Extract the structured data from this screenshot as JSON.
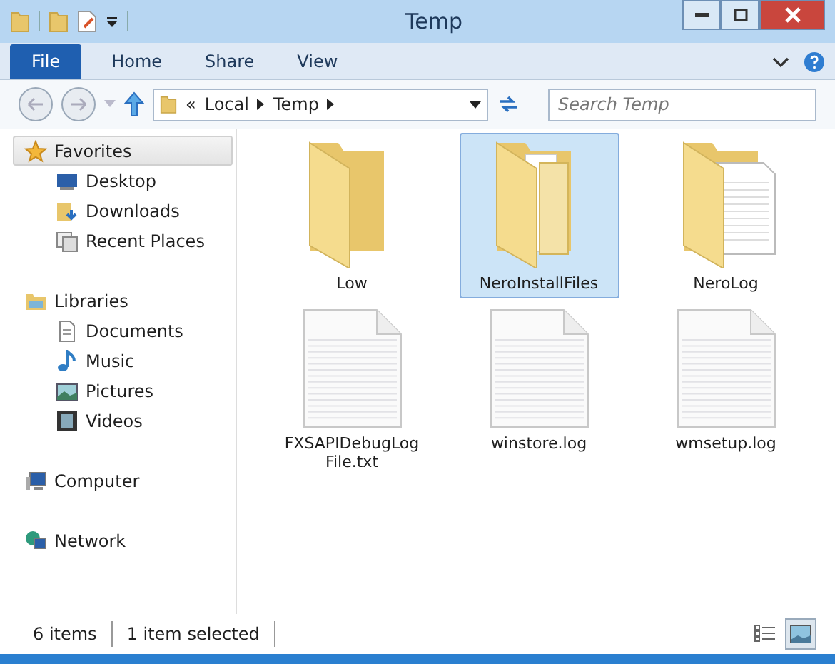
{
  "window": {
    "title": "Temp"
  },
  "quick_access": [
    {
      "kind": "folder"
    },
    {
      "kind": "properties"
    }
  ],
  "ribbon_tabs": [
    {
      "label": "File",
      "kind": "app-menu",
      "selected": false
    },
    {
      "label": "Home",
      "kind": "tab",
      "selected": false
    },
    {
      "label": "Share",
      "kind": "tab",
      "selected": false
    },
    {
      "label": "View",
      "kind": "tab",
      "selected": false
    }
  ],
  "address_bar": {
    "overflow": "«",
    "crumbs": [
      "Local",
      "Temp"
    ]
  },
  "search": {
    "placeholder": "Search Temp"
  },
  "navigation": [
    {
      "label": "Favorites",
      "kind": "star",
      "selected": true,
      "children": [
        {
          "label": "Desktop",
          "kind": "desktop",
          "selected": false
        },
        {
          "label": "Downloads",
          "kind": "downloads",
          "selected": false
        },
        {
          "label": "Recent Places",
          "kind": "recent",
          "selected": false
        }
      ]
    },
    {
      "label": "Libraries",
      "kind": "libraries",
      "selected": false,
      "children": [
        {
          "label": "Documents",
          "kind": "documents",
          "selected": false
        },
        {
          "label": "Music",
          "kind": "music",
          "selected": false
        },
        {
          "label": "Pictures",
          "kind": "pictures",
          "selected": false
        },
        {
          "label": "Videos",
          "kind": "videos",
          "selected": false
        }
      ]
    },
    {
      "label": "Computer",
      "kind": "computer",
      "selected": false
    },
    {
      "label": "Network",
      "kind": "network",
      "selected": false
    }
  ],
  "files": [
    {
      "name": "Low",
      "kind": "folder",
      "selected": false
    },
    {
      "name": "NeroInstallFiles",
      "kind": "folder-docs",
      "selected": true
    },
    {
      "name": "NeroLog",
      "kind": "folder-doc",
      "selected": false
    },
    {
      "name": "FXSAPIDebugLog File.txt",
      "kind": "file",
      "selected": false
    },
    {
      "name": "winstore.log",
      "kind": "file",
      "selected": false
    },
    {
      "name": "wmsetup.log",
      "kind": "file",
      "selected": false
    }
  ],
  "status_bar": {
    "item_count": "6 items",
    "selection": "1 item selected",
    "view_buttons": [
      {
        "kind": "details",
        "selected": false
      },
      {
        "kind": "large-icons",
        "selected": true
      }
    ]
  }
}
